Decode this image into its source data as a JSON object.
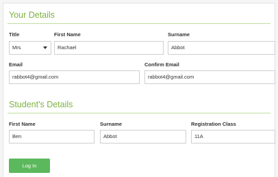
{
  "your_details": {
    "title": "Your Details",
    "title_label": "Title",
    "title_value": "Mrs",
    "first_name_label": "First Name",
    "first_name_value": "Rachael",
    "surname_label": "Surname",
    "surname_value": "Abbot",
    "email_label": "Email",
    "email_value": "rabbot4@gmail.com",
    "confirm_email_label": "Confirm Email",
    "confirm_email_value": "rabbot4@gmail.com"
  },
  "students_details": {
    "title": "Student's Details",
    "first_name_label": "First Name",
    "first_name_value": "Ben",
    "surname_label": "Surname",
    "surname_value": "Abbot",
    "registration_class_label": "Registration Class",
    "registration_class_value": "11A"
  },
  "actions": {
    "login_label": "Log In"
  },
  "colors": {
    "accent": "#7cb342",
    "button": "#5cb85c"
  },
  "icons": {
    "select_arrow": "chevron-down-icon"
  }
}
